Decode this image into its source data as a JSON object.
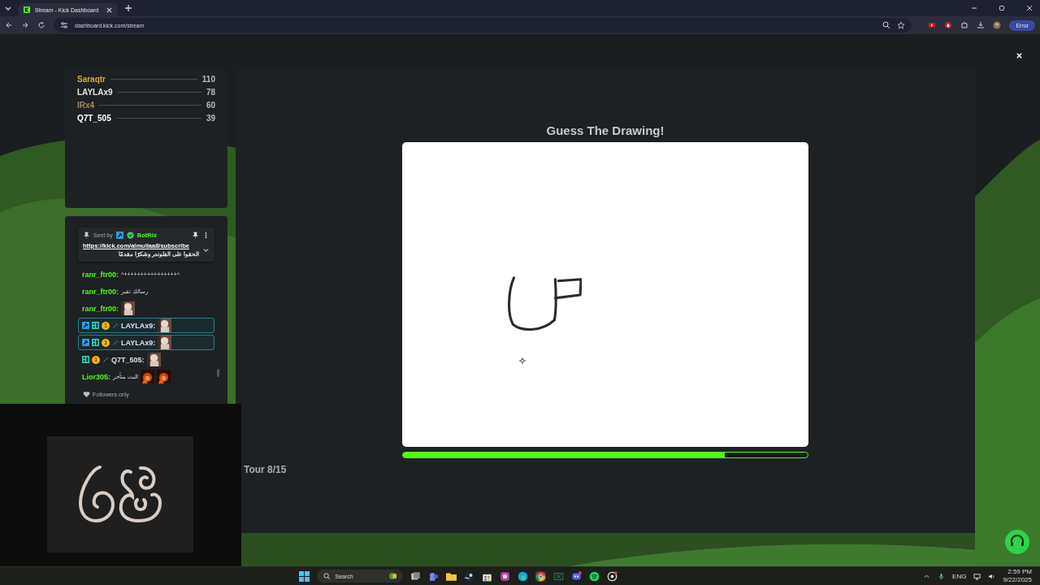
{
  "browser": {
    "tab_title": "Stream - Kick Dashboard",
    "url": "dashboard.kick.com/stream",
    "profile_button": "Error"
  },
  "leaderboard": [
    {
      "name": "Saraqtr",
      "score": "110",
      "color": "#d6a93e"
    },
    {
      "name": "LAYLAx9",
      "score": "78",
      "color": "#e4e4e4"
    },
    {
      "name": "IRx4",
      "score": "60",
      "color": "#a9845f"
    },
    {
      "name": "Q7T_505",
      "score": "39",
      "color": "#ffffff"
    }
  ],
  "chat": {
    "pinned": {
      "sent_by": "Sent by",
      "bot_name": "BotRix",
      "link": "https://kick.com/almullaa8/subscribe",
      "text": "الحقوا على الفلوندر وشكرًا مقدمًا"
    },
    "messages": [
      {
        "user": "ranr_ftr00:",
        "kind": "text",
        "text": "^++++++++++++++++^",
        "highlighted": false,
        "color": "#53fc18"
      },
      {
        "user": "ranr_ftr00:",
        "kind": "text",
        "text": "رسالك تقير",
        "highlighted": false,
        "color": "#53fc18"
      },
      {
        "user": "ranr_ftr00:",
        "kind": "emote",
        "highlighted": false,
        "color": "#53fc18"
      },
      {
        "user": "LAYLAx9:",
        "kind": "emote",
        "highlighted": true,
        "color": "#e2dcf0",
        "badges": [
          {
            "kind": "mod"
          },
          {
            "kind": "tier"
          },
          {
            "kind": "sub",
            "label": "1"
          },
          {
            "kind": "sparkle"
          }
        ]
      },
      {
        "user": "LAYLAx9:",
        "kind": "emote",
        "highlighted": true,
        "color": "#e2dcf0",
        "badges": [
          {
            "kind": "mod"
          },
          {
            "kind": "tier"
          },
          {
            "kind": "sub",
            "label": "1"
          },
          {
            "kind": "sparkle"
          }
        ]
      },
      {
        "user": "Q7T_505:",
        "kind": "emote",
        "highlighted": false,
        "color": "#e2dcf0",
        "badges": [
          {
            "kind": "tier"
          },
          {
            "kind": "sub",
            "label": "1"
          },
          {
            "kind": "sparkle"
          }
        ]
      },
      {
        "user": "Lior305:",
        "kind": "text_emote",
        "text": "البث متأخر",
        "highlighted": false,
        "color": "#53fc18"
      }
    ],
    "mode": "Followers only"
  },
  "game": {
    "title": "Guess The Drawing!",
    "progress": {
      "level": 0.796
    },
    "round": "Tour 8/15"
  },
  "taskbar": {
    "search": "Search",
    "language": "ENG",
    "time": "2:59 PM",
    "date": "9/22/2025"
  }
}
